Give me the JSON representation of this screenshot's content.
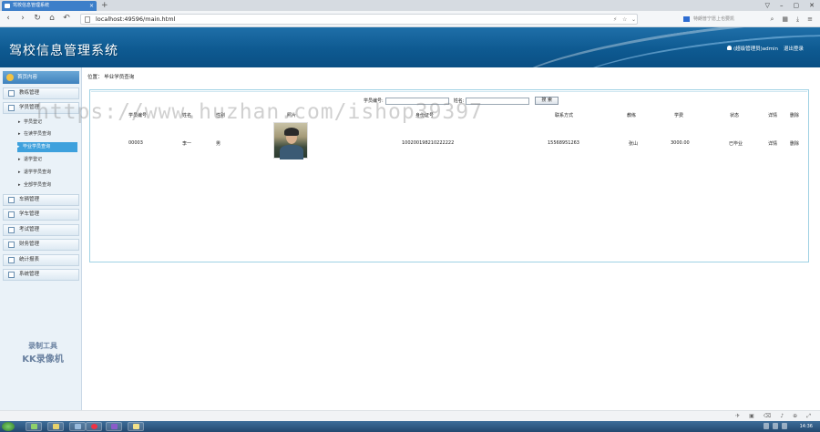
{
  "browser": {
    "tab_title": "驾校信息管理系统",
    "tab_close": "×",
    "new_tab": "+",
    "window_controls": [
      "▽",
      "–",
      "▢",
      "✕"
    ],
    "url": "localhost:49596/main.html",
    "search_placeholder": "特朗普宁愿上也要凯",
    "nav_icons": [
      "back-icon",
      "forward-icon",
      "reload-icon",
      "home-icon",
      "undo-icon"
    ]
  },
  "header": {
    "title": "驾校信息管理系统",
    "user": "(超级管理员)admin",
    "logout": "退出登录"
  },
  "sidebar": {
    "top": "首页内容",
    "items": [
      {
        "label": "教练管理"
      },
      {
        "label": "学员管理"
      },
      {
        "label": "车辆管理"
      },
      {
        "label": "学车管理"
      },
      {
        "label": "考试管理"
      },
      {
        "label": "财务管理"
      },
      {
        "label": "统计报表"
      },
      {
        "label": "系统管理"
      }
    ],
    "subitems": [
      {
        "label": "学员登记"
      },
      {
        "label": "在读学员查询"
      },
      {
        "label": "毕业学员查询"
      },
      {
        "label": "退学登记"
      },
      {
        "label": "退学学员查询"
      },
      {
        "label": "全部学员查询"
      }
    ],
    "watermark_line1": "录制工具",
    "watermark_line2": "KK录像机"
  },
  "main": {
    "breadcrumb_label": "位置：",
    "breadcrumb_value": "毕业学员查询",
    "search": {
      "id_label": "学员编号:",
      "id_value": "",
      "name_label": "姓名:",
      "name_value": "",
      "button": "搜 索"
    },
    "columns": [
      "学员编号",
      "姓名",
      "性别",
      "照片",
      "身份证号",
      "联系方式",
      "教练",
      "学费",
      "状态",
      "详情",
      "删除"
    ],
    "rows": [
      {
        "id": "00003",
        "name": "李一",
        "gender": "男",
        "idcard": "100200198210222222",
        "phone": "15568951263",
        "coach": "张山",
        "fee": "3000.00",
        "status": "已毕业",
        "detail": "详情",
        "delete": "删除"
      }
    ]
  },
  "overlay_watermark": "https://www.huzhan.com/ishop39397",
  "taskbar": {
    "clock": "14:36"
  },
  "colors": {
    "header": "#0e5a91",
    "active": "#3ea1dd",
    "panel_border": "#9fd2e4"
  }
}
